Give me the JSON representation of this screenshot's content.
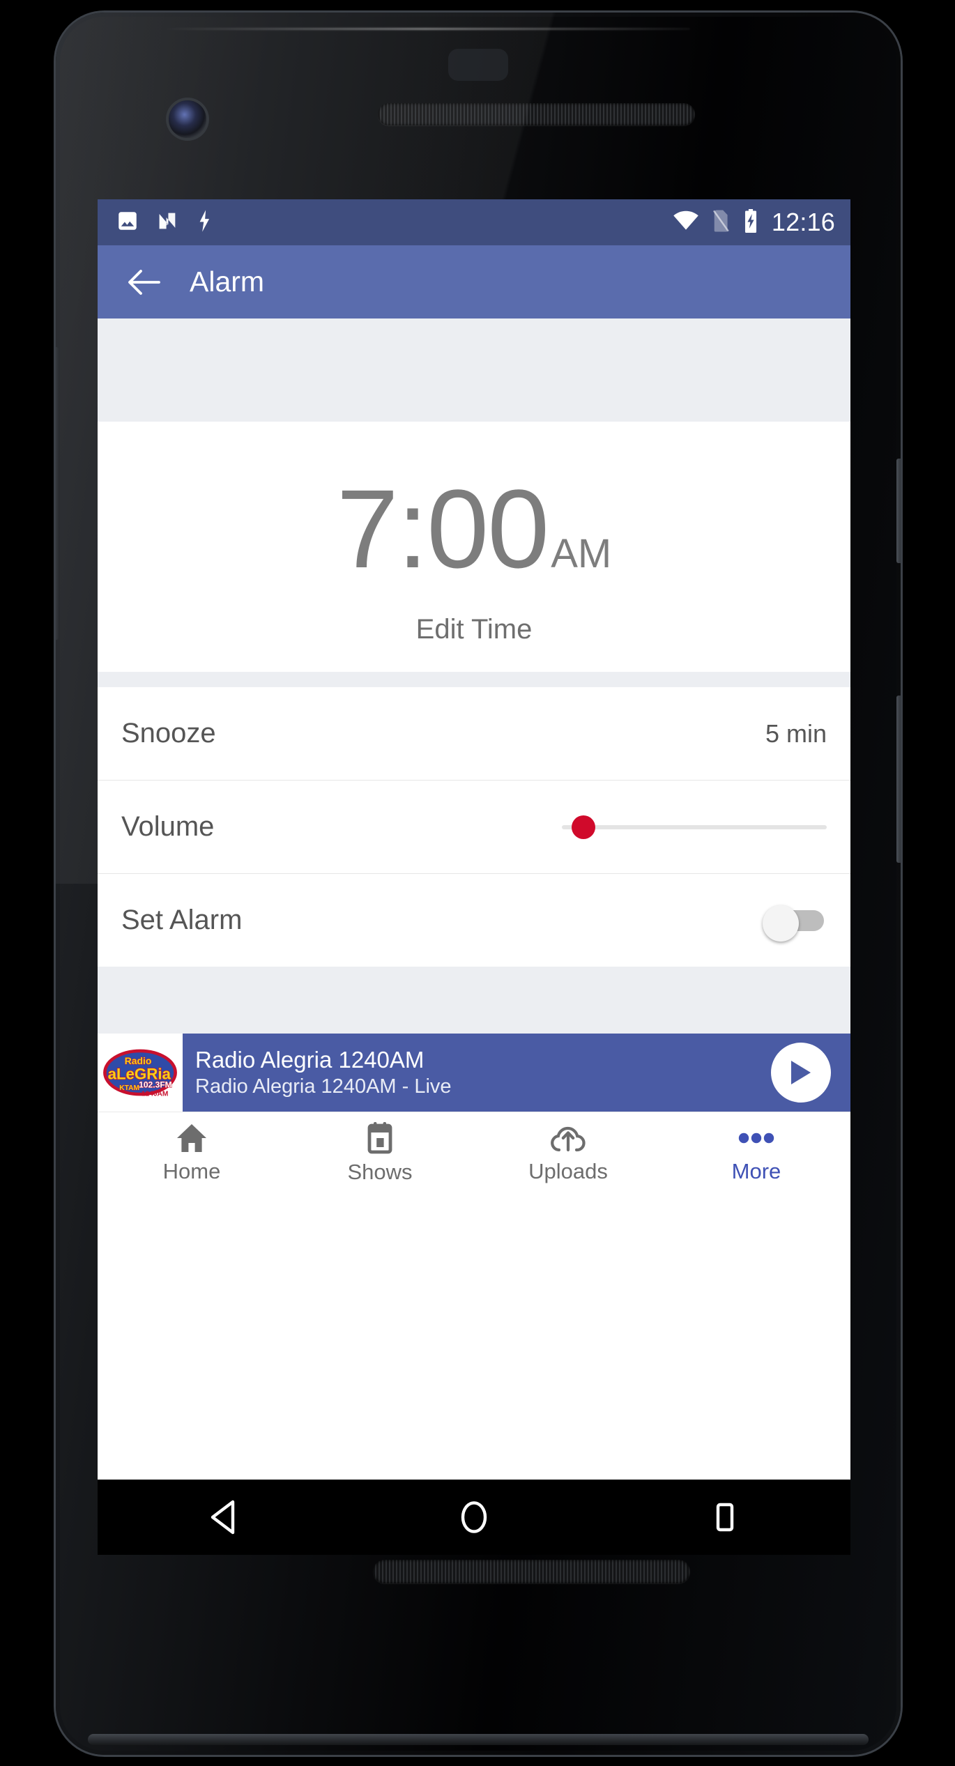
{
  "status_bar": {
    "time": "12:16",
    "left_icons": [
      "image-icon",
      "android-nougat-icon",
      "bolt-icon"
    ],
    "right_icons": [
      "wifi-icon",
      "no-sim-icon",
      "battery-charging-icon"
    ],
    "background": "#3f4d7e"
  },
  "app_bar": {
    "back_icon": "arrow-back-icon",
    "title": "Alarm",
    "background": "#5a6cad"
  },
  "alarm": {
    "time": "7:00",
    "meridiem": "AM",
    "edit_label": "Edit Time",
    "time_color": "#7d7d7d"
  },
  "settings_rows": [
    {
      "label": "Snooze",
      "value": "5 min",
      "control": "text"
    },
    {
      "label": "Volume",
      "value": "",
      "control": "slider",
      "slider_fill_percent": 5,
      "accent": "#d00a2b"
    },
    {
      "label": "Set Alarm",
      "value": "",
      "control": "toggle",
      "toggle_on": false
    }
  ],
  "player": {
    "title": "Radio Alegria 1240AM",
    "subtitle": "Radio Alegria 1240AM - Live",
    "play_icon": "play-icon",
    "background": "#4a5ba4",
    "artwork": {
      "line1": "Radio",
      "line2": "aLeGRia",
      "line3": "KTAM",
      "line4": "102.3FM",
      "line5": "1240AM"
    }
  },
  "bottom_nav": {
    "active_color": "#3f51b5",
    "items": [
      {
        "label": "Home",
        "icon": "home-icon",
        "active": false
      },
      {
        "label": "Shows",
        "icon": "calendar-icon",
        "active": false
      },
      {
        "label": "Uploads",
        "icon": "cloud-upload-icon",
        "active": false
      },
      {
        "label": "More",
        "icon": "more-dots-icon",
        "active": true
      }
    ]
  },
  "android_nav": {
    "back": "triangle-back-icon",
    "home": "circle-home-icon",
    "recents": "square-recents-icon"
  }
}
